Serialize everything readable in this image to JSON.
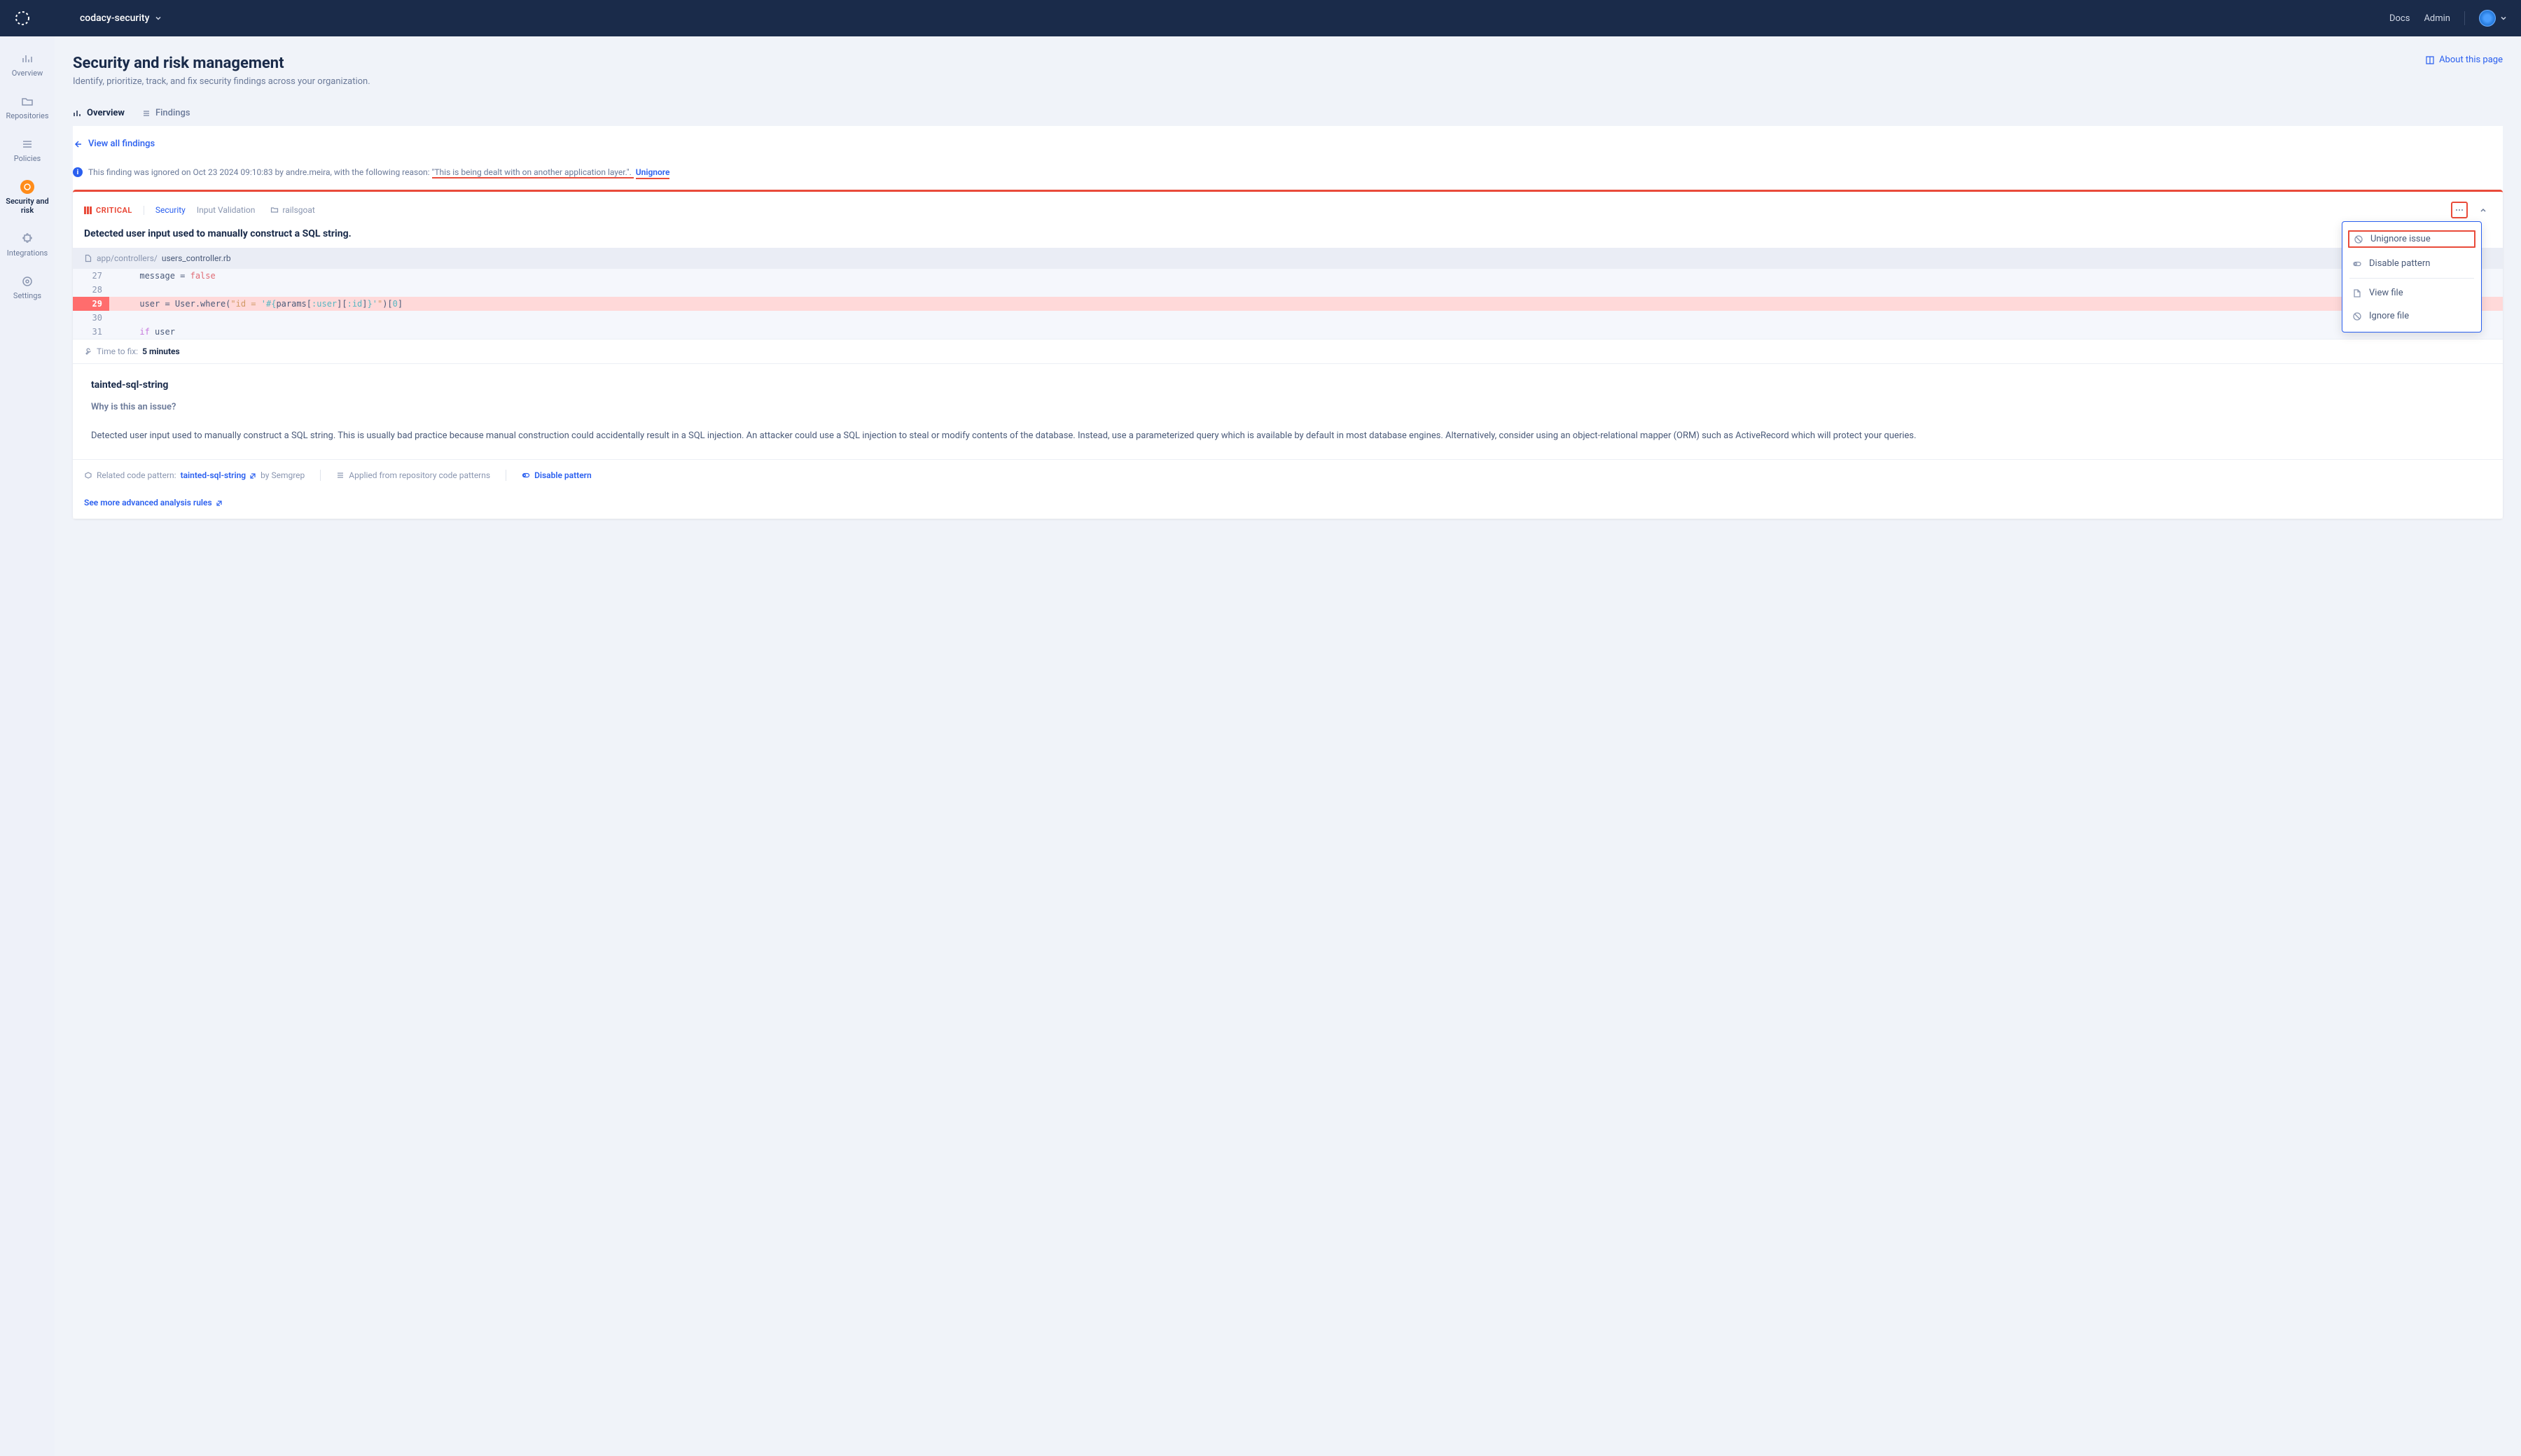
{
  "topnav": {
    "org": "codacy-security",
    "links": {
      "docs": "Docs",
      "admin": "Admin"
    }
  },
  "sidebar": {
    "items": [
      {
        "label": "Overview"
      },
      {
        "label": "Repositories"
      },
      {
        "label": "Policies"
      },
      {
        "label": "Security and risk"
      },
      {
        "label": "Integrations"
      },
      {
        "label": "Settings"
      }
    ]
  },
  "header": {
    "title": "Security and risk management",
    "subtitle": "Identify, prioritize, track, and fix security findings across your organization.",
    "about": "About this page"
  },
  "tabs": {
    "overview": "Overview",
    "findings": "Findings"
  },
  "back": "View all findings",
  "info_bar": {
    "prefix": "This finding was ignored on Oct 23 2024 09:10:83 by andre.meira, with the following reason: ",
    "reason": "\"This is being dealt with on another application layer.\". ",
    "unignore": "Unignore"
  },
  "finding": {
    "severity": "CRITICAL",
    "category": "Security",
    "subcategory": "Input Validation",
    "repo": "railsgoat",
    "title": "Detected user input used to manually construct a SQL string.",
    "file_path_prefix": "app/controllers/",
    "file_name": "users_controller.rb",
    "code": {
      "l27": {
        "num": "27",
        "text": "      message = false"
      },
      "l28": {
        "num": "28",
        "text": ""
      },
      "l29": {
        "num": "29",
        "text": "      user = User.where(\"id = '#{params[:user][:id]}'\")[0]"
      },
      "l30": {
        "num": "30",
        "text": ""
      },
      "l31": {
        "num": "31",
        "text": "      if user"
      }
    },
    "time_to_fix_label": "Time to fix: ",
    "time_to_fix_value": "5 minutes"
  },
  "dropdown": {
    "unignore": "Unignore issue",
    "disable": "Disable pattern",
    "viewfile": "View file",
    "ignorefile": "Ignore file"
  },
  "detail": {
    "rule_name": "tainted-sql-string",
    "why": "Why is this an issue?",
    "description": "Detected user input used to manually construct a SQL string. This is usually bad practice because manual construction could accidentally result in a SQL injection. An attacker could use a SQL injection to steal or modify contents of the database. Instead, use a parameterized query which is available by default in most database engines. Alternatively, consider using an object-relational mapper (ORM) such as ActiveRecord which will protect your queries."
  },
  "footer": {
    "related_prefix": "Related code pattern: ",
    "pattern_name": "tainted-sql-string",
    "by": " by Semgrep",
    "applied": "Applied from repository code patterns",
    "disable": "Disable pattern",
    "advanced": "See more advanced analysis rules"
  }
}
